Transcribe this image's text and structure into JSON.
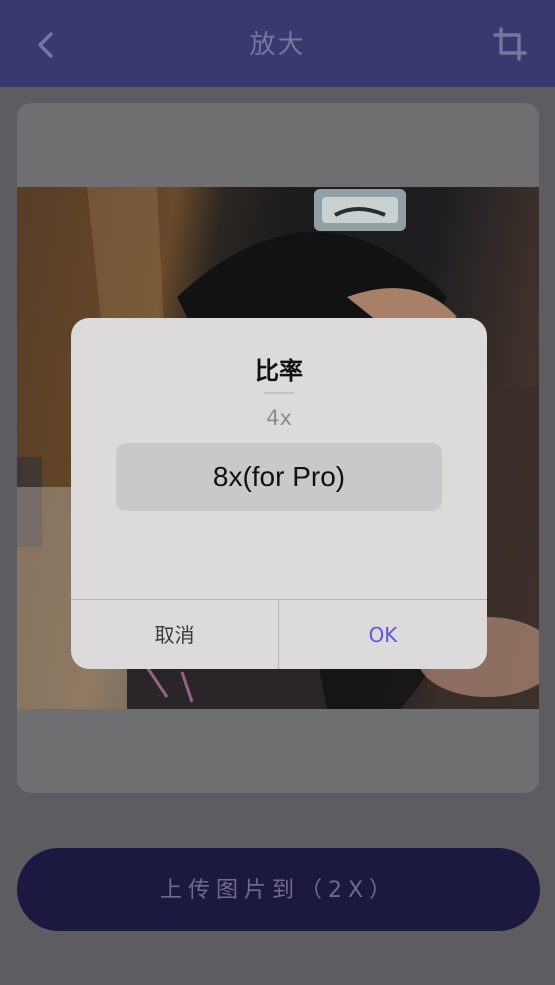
{
  "navbar": {
    "title": "放大"
  },
  "dialog": {
    "title": "比率",
    "picker": {
      "previous": "4x",
      "selected": "8x(for Pro)"
    },
    "cancel": "取消",
    "ok": "OK"
  },
  "upload_button": {
    "label": "上传图片到（2X）"
  },
  "colors": {
    "navbar": "#393970",
    "primary": "#1c1941",
    "ok_text": "#5a56e6"
  },
  "icons": {
    "back": "chevron-left-icon",
    "crop": "crop-icon"
  }
}
